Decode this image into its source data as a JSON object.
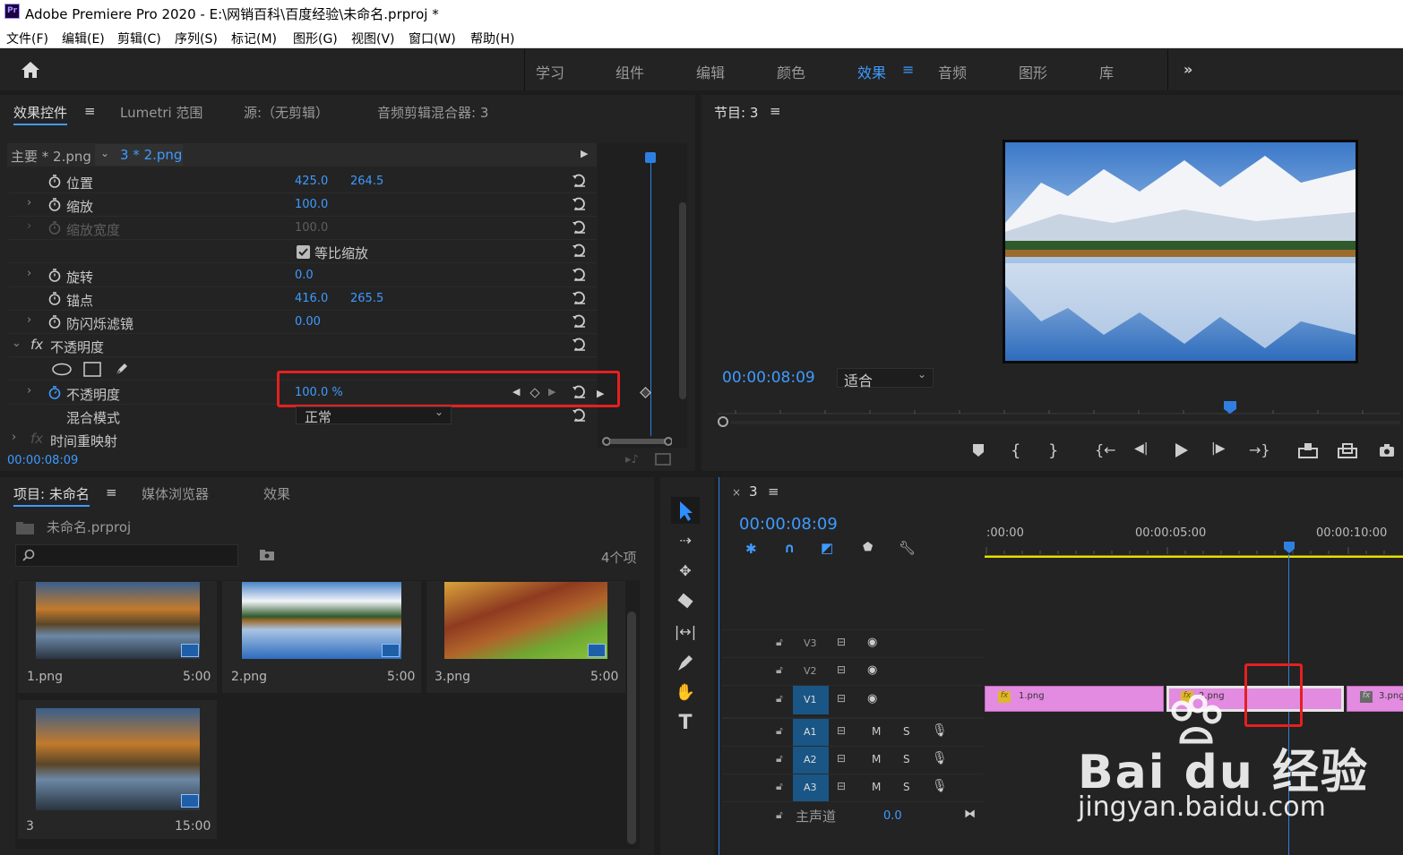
{
  "window": {
    "title": "Adobe Premiere Pro 2020 - E:\\网销百科\\百度经验\\未命名.prproj *",
    "app_icon": "Pr"
  },
  "menu": [
    "文件(F)",
    "编辑(E)",
    "剪辑(C)",
    "序列(S)",
    "标记(M)",
    "图形(G)",
    "视图(V)",
    "窗口(W)",
    "帮助(H)"
  ],
  "workspaces": {
    "tabs": [
      "学习",
      "组件",
      "编辑",
      "颜色",
      "效果",
      "音频",
      "图形",
      "库"
    ],
    "active": "效果",
    "more": "»"
  },
  "effect_controls": {
    "tabs": [
      "效果控件",
      "Lumetri 范围",
      "源:（无剪辑）",
      "音频剪辑混合器: 3"
    ],
    "clip_master": "主要 * 2.png",
    "clip_current": "3 * 2.png",
    "properties": [
      {
        "name": "位置",
        "v1": "425.0",
        "v2": "264.5"
      },
      {
        "name": "缩放",
        "v1": "100.0",
        "v2": ""
      },
      {
        "name": "缩放宽度",
        "v1": "100.0",
        "v2": ""
      },
      {
        "name": "等比缩放",
        "v1": "",
        "v2": ""
      },
      {
        "name": "旋转",
        "v1": "0.0",
        "v2": ""
      },
      {
        "name": "锚点",
        "v1": "416.0",
        "v2": "265.5"
      },
      {
        "name": "防闪烁滤镜",
        "v1": "0.00",
        "v2": ""
      }
    ],
    "opacity_section": "不透明度",
    "opacity_prop": "不透明度",
    "opacity_value": "100.0 %",
    "blend_label": "混合模式",
    "blend_value": "正常",
    "time_remap": "时间重映射",
    "fx": "fx",
    "timecode": "00:00:08:09"
  },
  "program": {
    "title": "节目: 3",
    "timecode": "00:00:08:09",
    "fit": "适合"
  },
  "project": {
    "tabs": [
      "项目: 未命名",
      "媒体浏览器",
      "效果"
    ],
    "file": "未命名.prproj",
    "count": "4个项",
    "items": [
      {
        "name": "1.png",
        "dur": "5:00"
      },
      {
        "name": "2.png",
        "dur": "5:00"
      },
      {
        "name": "3.png",
        "dur": "5:00"
      },
      {
        "name": "3",
        "dur": "15:00"
      }
    ]
  },
  "timeline": {
    "tab": "3",
    "timecode": "00:00:08:09",
    "ruler": [
      ":00:00",
      "00:00:05:00",
      "00:00:10:00"
    ],
    "tracks_video": [
      "V3",
      "V2",
      "V1"
    ],
    "tracks_audio": [
      "A1",
      "A2",
      "A3"
    ],
    "mute": "M",
    "solo": "S",
    "master": "主声道",
    "master_val": "0.0",
    "clips": [
      "1.png",
      "2.png",
      "3.png"
    ]
  },
  "watermark": {
    "text": "Bai du 经验",
    "url": "jingyan.baidu.com"
  }
}
